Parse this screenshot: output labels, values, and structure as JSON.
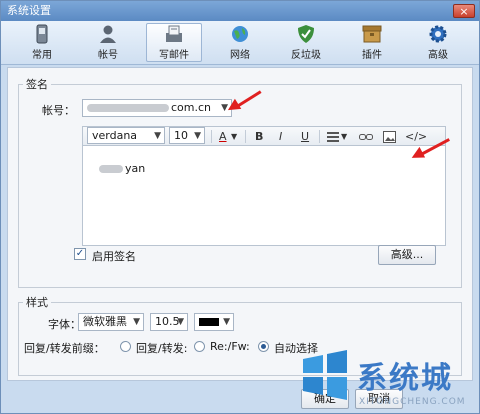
{
  "window": {
    "title": "系统设置",
    "close_glyph": "×"
  },
  "toolbar": {
    "items": [
      {
        "label": "常用",
        "icon": "phone-icon"
      },
      {
        "label": "帐号",
        "icon": "person-icon"
      },
      {
        "label": "写邮件",
        "icon": "compose-icon",
        "active": true
      },
      {
        "label": "网络",
        "icon": "globe-icon"
      },
      {
        "label": "反垃圾",
        "icon": "shield-icon"
      },
      {
        "label": "插件",
        "icon": "box-icon"
      },
      {
        "label": "高级",
        "icon": "gear-icon"
      }
    ]
  },
  "signature": {
    "legend": "签名",
    "account_label": "帐号：",
    "account_value_suffix": "com.cn",
    "font_name": "verdana",
    "font_size": "10",
    "format_buttons": {
      "bold": "B",
      "italic": "I",
      "underline": "U",
      "source": "</>"
    },
    "editor_text_suffix": "yan",
    "enable_label": "启用签名",
    "enable_checked": true,
    "advanced_button": "高级..."
  },
  "style": {
    "legend": "样式",
    "font_label": "字体：",
    "font_value": "微软雅黑",
    "size_value": "10.5",
    "color_value": "#000000",
    "prefix_label": "回复/转发前缀：",
    "options": [
      "回复/转发:",
      "Re:/Fw:",
      "自动选择"
    ],
    "selected_option": 2
  },
  "footer": {
    "ok": "确定",
    "cancel": "取消"
  },
  "watermark": {
    "text": "系统城",
    "url": "XITONGCHENG.COM"
  },
  "colors": {
    "accent": "#3b79c6",
    "annotation_arrow": "#e02020"
  }
}
